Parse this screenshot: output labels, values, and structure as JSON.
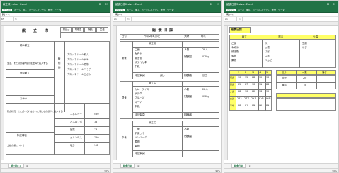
{
  "window1": {
    "title": "献立表1.xlsx - Excel",
    "ribbon": [
      "ファイル",
      "ホーム",
      "挿入",
      "ページレイアウト",
      "数式",
      "データ",
      "校閲",
      "表示"
    ],
    "namebox": "K5",
    "sheet_title": "献　立　表",
    "header_cells": [
      "栄養士",
      "調理員",
      "所長",
      "主任"
    ],
    "row_labels": [
      "朝の献立",
      "昼の献立",
      "おやつ",
      "夕方の献立",
      "特記事項"
    ],
    "menu_items": [
      "ブロッコリーの和え",
      "ブロッコリーの炒め",
      "ブロッコリーの煮物",
      "ブロッコリーのサラダ",
      "ブロッコリーの天ぷら"
    ],
    "note1": "生活、または食事内容の変更等を記入する",
    "note2": "残食状況、また食べられなかった子どもの様子を記入する",
    "note3": "上記の欄について",
    "side_label": "食　材　料",
    "kcal_labels": [
      "エネルギー",
      "たんぱく質",
      "脂質",
      "カルシウム",
      "塩分"
    ],
    "kcal_values": [
      "450",
      "18",
      "13",
      "150",
      "1.8"
    ],
    "tab": "献立表(1)",
    "zoom": "90%"
  },
  "window2": {
    "title": "給食日誌2.xlsx - Excel",
    "ribbon": [
      "ファイル",
      "ホーム",
      "挿入",
      "ページレイアウト",
      "数式",
      "データ",
      "校閲",
      "表示"
    ],
    "namebox": "A1",
    "sheet_title": "給食日誌",
    "date_label": "日付",
    "date_value": "令和2年4月1日",
    "weather_label": "天気",
    "weather_value": "晴れ",
    "sections": [
      "朝食",
      "昼食",
      "夕食"
    ],
    "sub_headers": [
      "献立名",
      "食材",
      "品目"
    ],
    "menu_breakfast": [
      "ご飯",
      "みそ汁",
      "焼き魚",
      "ほうれん草",
      "牛乳"
    ],
    "menu_lunch": [
      "カレーライス",
      "サラダ",
      "フルーツ",
      "スープ",
      "牛乳"
    ],
    "menu_dinner": [
      "ご飯",
      "すまし汁",
      "ハンバーグ",
      "煮物",
      "果物"
    ],
    "labels": [
      "人数",
      "残食量",
      "特記事項",
      "検食者"
    ],
    "values": [
      "25人",
      "0.2kg",
      "なし",
      "山田"
    ],
    "tab": "給食日誌",
    "zoom": "90%"
  },
  "window3": {
    "title": "給食日誌3.xlsx - Excel",
    "ribbon": [
      "ファイル",
      "ホーム",
      "挿入",
      "ページレイアウト",
      "数式",
      "データ",
      "校閲",
      "表示"
    ],
    "namebox": "A1",
    "sheet_title": "給食日誌",
    "col_heads": [
      "献立",
      "材料",
      "分量"
    ],
    "menu_col": [
      "ご飯",
      "みそ汁",
      "焼き魚",
      "煮物",
      "果物"
    ],
    "ingredients": [
      "米",
      "大根",
      "さば",
      "人参",
      "りんご",
      "豆腐",
      "ねぎ"
    ],
    "grid_heads": [
      "",
      "1",
      "2",
      "3",
      "4",
      "5"
    ],
    "grid_rows": [
      {
        "label": "朝食",
        "cells": [
          "90",
          "95",
          "88",
          "92",
          "90"
        ]
      },
      {
        "label": "昼食",
        "cells": [
          "85",
          "87",
          "90",
          "91",
          "86"
        ]
      },
      {
        "label": "夕食",
        "cells": [
          "88",
          "90",
          "89",
          "93",
          "92"
        ]
      },
      {
        "label": "合計",
        "cells": [
          "263",
          "272",
          "267",
          "276",
          "268"
        ]
      },
      {
        "label": "平均",
        "cells": [
          "88",
          "91",
          "89",
          "92",
          "89"
        ]
      }
    ],
    "right_heads": [
      "区分",
      "人数",
      "備考"
    ],
    "right_values": [
      "幼児",
      "20",
      ""
    ],
    "right_values2": [
      "職員",
      "5",
      ""
    ],
    "tab": "給食日誌",
    "zoom": "90%"
  }
}
